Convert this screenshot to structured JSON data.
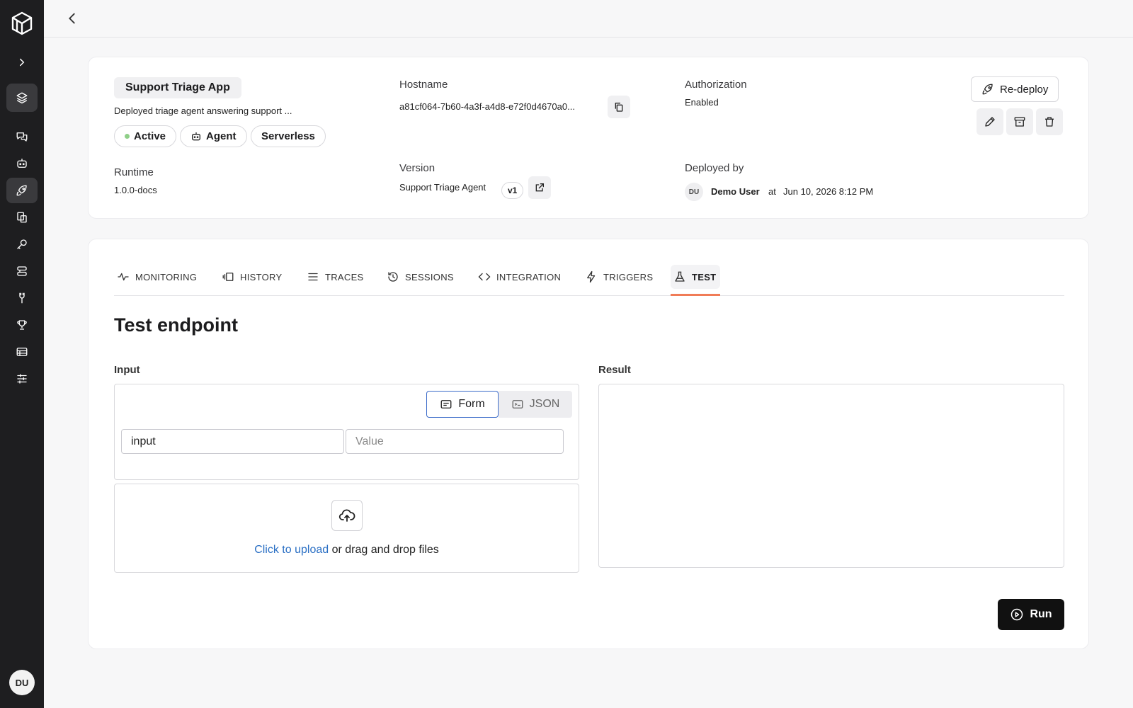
{
  "sidebar": {
    "items": [
      {
        "icon": "chevron-right-icon"
      },
      {
        "icon": "layers-icon"
      },
      {
        "icon": "chat-icon"
      },
      {
        "icon": "bot-icon"
      },
      {
        "icon": "rocket-icon"
      },
      {
        "icon": "docs-icon"
      },
      {
        "icon": "key-icon"
      },
      {
        "icon": "database-icon"
      },
      {
        "icon": "tools-icon"
      },
      {
        "icon": "trophy-icon"
      },
      {
        "icon": "table-icon"
      },
      {
        "icon": "sliders-icon"
      }
    ],
    "active_index": 4,
    "avatar_initials": "DU"
  },
  "app": {
    "name": "Support Triage App",
    "description": "Deployed triage agent answering support ...",
    "badges": [
      "Active",
      "Agent",
      "Serverless"
    ],
    "status_color": "#8fcf88"
  },
  "info": {
    "hostname_label": "Hostname",
    "hostname_value": "a81cf064-7b60-4a3f-a4d8-e72f0d4670a0...",
    "authorization_label": "Authorization",
    "authorization_value": "Enabled",
    "runtime_label": "Runtime",
    "runtime_value": "1.0.0-docs",
    "version_label": "Version",
    "version_value": "Support Triage Agent",
    "version_badge": "v1",
    "deployed_by_label": "Deployed by",
    "deployed_by_initials": "DU",
    "deployed_by_name": "Demo User",
    "deployed_at_prefix": "at",
    "deployed_at": "Jun 10, 2026 8:12 PM"
  },
  "actions": {
    "redeploy_label": "Re-deploy"
  },
  "tabs": [
    {
      "label": "MONITORING",
      "icon": "activity-icon"
    },
    {
      "label": "HISTORY",
      "icon": "history-icon"
    },
    {
      "label": "TRACES",
      "icon": "list-icon"
    },
    {
      "label": "SESSIONS",
      "icon": "clock-icon"
    },
    {
      "label": "INTEGRATION",
      "icon": "code-icon"
    },
    {
      "label": "TRIGGERS",
      "icon": "bolt-icon"
    },
    {
      "label": "TEST",
      "icon": "flask-icon"
    }
  ],
  "active_tab": "TEST",
  "accent_color": "#f07c57",
  "test": {
    "title": "Test endpoint",
    "input_label": "Input",
    "result_label": "Result",
    "mode_form": "Form",
    "mode_json": "JSON",
    "key_field_value": "input",
    "value_placeholder": "Value",
    "upload_link": "Click to upload",
    "upload_rest": " or drag and drop files",
    "run_label": "Run"
  }
}
